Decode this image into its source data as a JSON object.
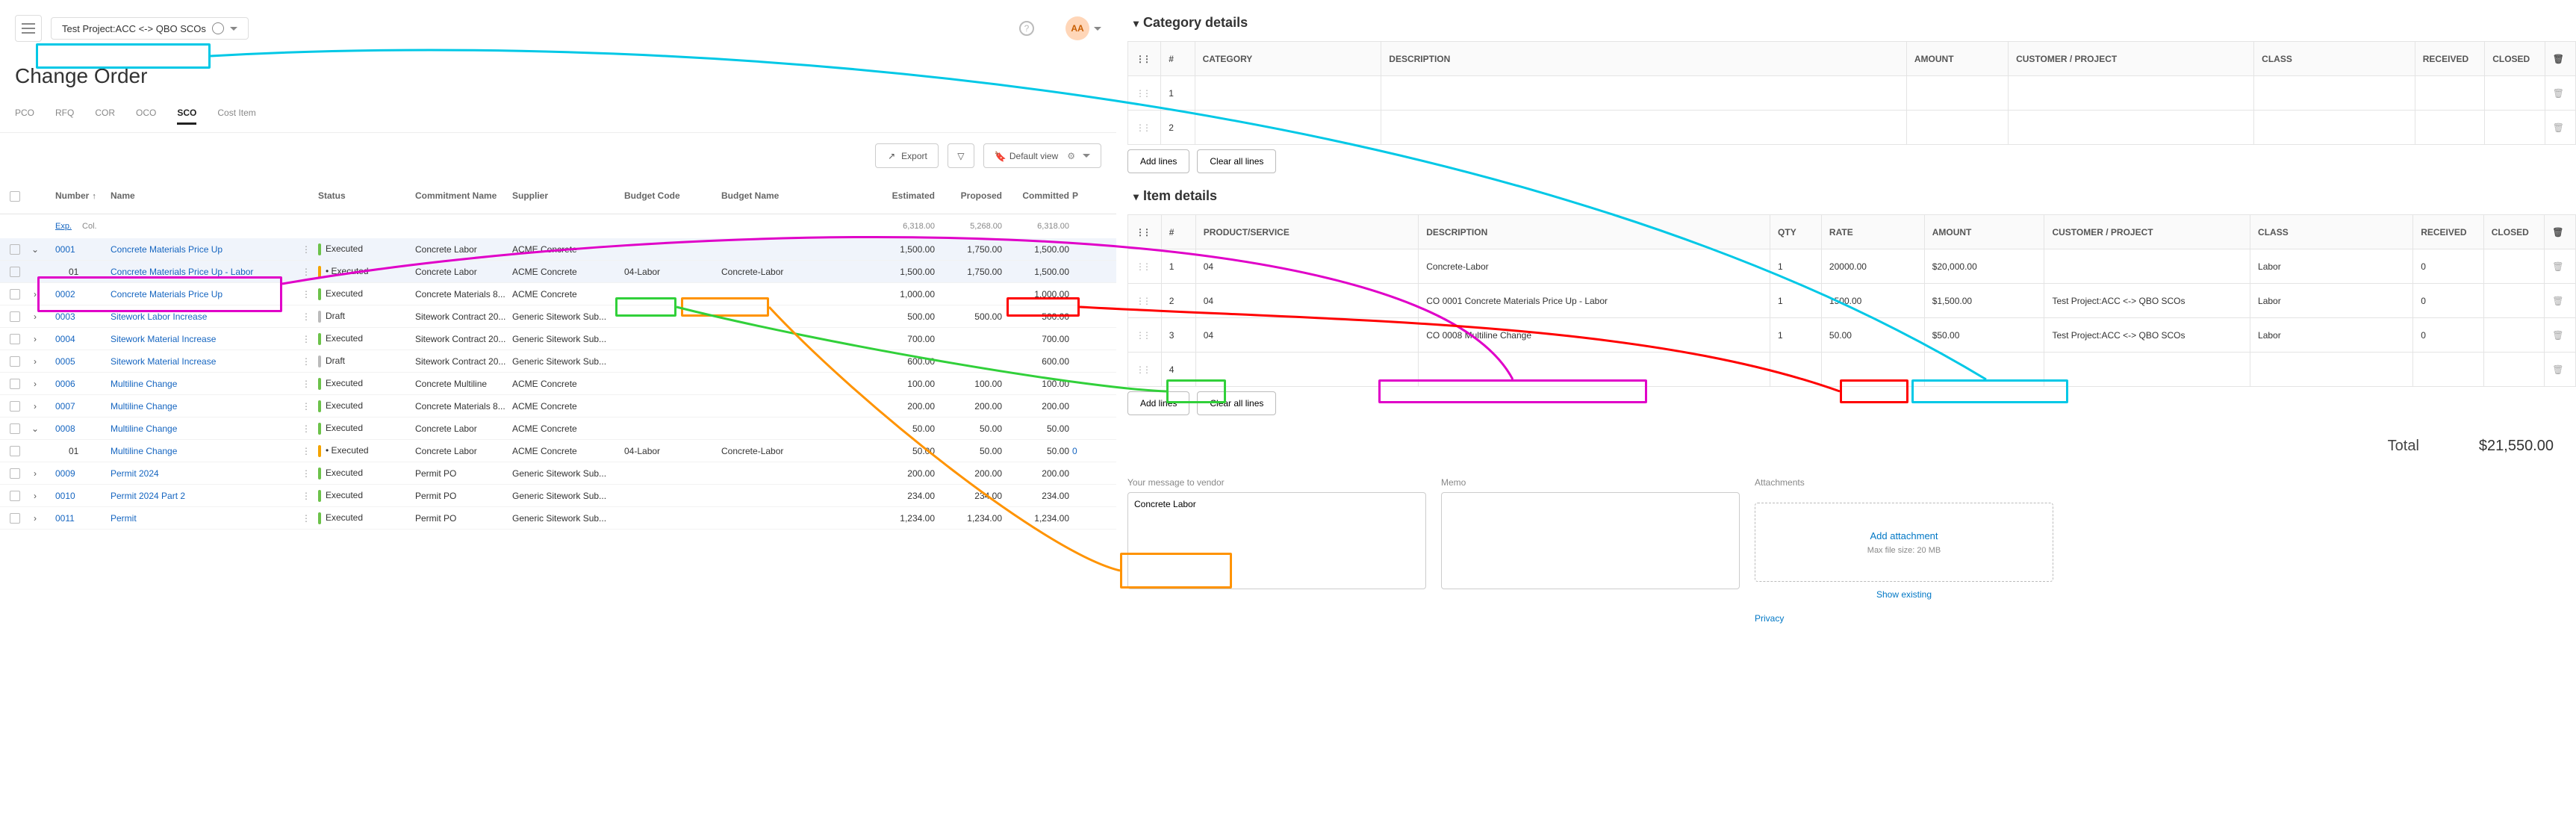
{
  "header": {
    "project_name": "Test Project:ACC <-> QBO SCOs",
    "avatar_initials": "AA"
  },
  "page": {
    "title": "Change Order"
  },
  "tabs": {
    "items": [
      "PCO",
      "RFQ",
      "COR",
      "OCO",
      "SCO",
      "Cost Item"
    ],
    "active": "SCO"
  },
  "toolbar": {
    "export": "Export",
    "default_view": "Default view"
  },
  "grid": {
    "columns": {
      "number": "Number",
      "name": "Name",
      "status": "Status",
      "commitment": "Commitment Name",
      "supplier": "Supplier",
      "budget_code": "Budget Code",
      "budget_name": "Budget Name",
      "estimated": "Estimated",
      "proposed": "Proposed",
      "committed": "Committed",
      "p": "P"
    },
    "subtabs": {
      "exp": "Exp.",
      "col": "Col."
    },
    "summary": {
      "estimated": "6,318.00",
      "proposed": "5,268.00",
      "committed": "6,318.00"
    },
    "rows": [
      {
        "exp": "v",
        "number": "0001",
        "name": "Concrete Materials Price Up",
        "status": "Executed",
        "status_cls": "status-exec",
        "commitment": "Concrete Labor",
        "supplier": "ACME Concrete",
        "budget_code": "",
        "budget_name": "",
        "estimated": "1,500.00",
        "proposed": "1,750.00",
        "committed": "1,500.00",
        "p": ""
      },
      {
        "exp": "",
        "number": "01",
        "name": "Concrete Materials Price Up - Labor",
        "status": "Executed",
        "status_cls": "status-ext",
        "commitment": "Concrete Labor",
        "supplier": "ACME Concrete",
        "budget_code": "04-Labor",
        "budget_name": "Concrete-Labor",
        "estimated": "1,500.00",
        "proposed": "1,750.00",
        "committed": "1,500.00",
        "p": ""
      },
      {
        "exp": ">",
        "number": "0002",
        "name": "Concrete Materials Price Up",
        "status": "Executed",
        "status_cls": "status-exec",
        "commitment": "Concrete Materials 8...",
        "supplier": "ACME Concrete",
        "budget_code": "",
        "budget_name": "",
        "estimated": "1,000.00",
        "proposed": "",
        "committed": "1,000.00",
        "p": ""
      },
      {
        "exp": ">",
        "number": "0003",
        "name": "Sitework Labor Increase",
        "status": "Draft",
        "status_cls": "status-draft",
        "commitment": "Sitework Contract 20...",
        "supplier": "Generic Sitework Sub...",
        "budget_code": "",
        "budget_name": "",
        "estimated": "500.00",
        "proposed": "500.00",
        "committed": "500.00",
        "p": ""
      },
      {
        "exp": ">",
        "number": "0004",
        "name": "Sitework Material Increase",
        "status": "Executed",
        "status_cls": "status-exec",
        "commitment": "Sitework Contract 20...",
        "supplier": "Generic Sitework Sub...",
        "budget_code": "",
        "budget_name": "",
        "estimated": "700.00",
        "proposed": "",
        "committed": "700.00",
        "p": ""
      },
      {
        "exp": ">",
        "number": "0005",
        "name": "Sitework Material Increase",
        "status": "Draft",
        "status_cls": "status-draft",
        "commitment": "Sitework Contract 20...",
        "supplier": "Generic Sitework Sub...",
        "budget_code": "",
        "budget_name": "",
        "estimated": "600.00",
        "proposed": "",
        "committed": "600.00",
        "p": ""
      },
      {
        "exp": ">",
        "number": "0006",
        "name": "Multiline Change",
        "status": "Executed",
        "status_cls": "status-exec",
        "commitment": "Concrete Multiline",
        "supplier": "ACME Concrete",
        "budget_code": "",
        "budget_name": "",
        "estimated": "100.00",
        "proposed": "100.00",
        "committed": "100.00",
        "p": ""
      },
      {
        "exp": ">",
        "number": "0007",
        "name": "Multiline Change",
        "status": "Executed",
        "status_cls": "status-exec",
        "commitment": "Concrete Materials 8...",
        "supplier": "ACME Concrete",
        "budget_code": "",
        "budget_name": "",
        "estimated": "200.00",
        "proposed": "200.00",
        "committed": "200.00",
        "p": ""
      },
      {
        "exp": "v",
        "number": "0008",
        "name": "Multiline Change",
        "status": "Executed",
        "status_cls": "status-exec",
        "commitment": "Concrete Labor",
        "supplier": "ACME Concrete",
        "budget_code": "",
        "budget_name": "",
        "estimated": "50.00",
        "proposed": "50.00",
        "committed": "50.00",
        "p": ""
      },
      {
        "exp": "",
        "number": "01",
        "name": "Multiline Change",
        "status": "Executed",
        "status_cls": "status-ext",
        "commitment": "Concrete Labor",
        "supplier": "ACME Concrete",
        "budget_code": "04-Labor",
        "budget_name": "Concrete-Labor",
        "estimated": "50.00",
        "proposed": "50.00",
        "committed": "50.00",
        "p": "0"
      },
      {
        "exp": ">",
        "number": "0009",
        "name": "Permit 2024",
        "status": "Executed",
        "status_cls": "status-exec",
        "commitment": "Permit PO",
        "supplier": "Generic Sitework Sub...",
        "budget_code": "",
        "budget_name": "",
        "estimated": "200.00",
        "proposed": "200.00",
        "committed": "200.00",
        "p": ""
      },
      {
        "exp": ">",
        "number": "0010",
        "name": "Permit 2024 Part 2",
        "status": "Executed",
        "status_cls": "status-exec",
        "commitment": "Permit PO",
        "supplier": "Generic Sitework Sub...",
        "budget_code": "",
        "budget_name": "",
        "estimated": "234.00",
        "proposed": "234.00",
        "committed": "234.00",
        "p": ""
      },
      {
        "exp": ">",
        "number": "0011",
        "name": "Permit",
        "status": "Executed",
        "status_cls": "status-exec",
        "commitment": "Permit PO",
        "supplier": "Generic Sitework Sub...",
        "budget_code": "",
        "budget_name": "",
        "estimated": "1,234.00",
        "proposed": "1,234.00",
        "committed": "1,234.00",
        "p": ""
      }
    ]
  },
  "qbo": {
    "category": {
      "title": "Category details",
      "columns": {
        "n": "#",
        "cat": "CATEGORY",
        "desc": "DESCRIPTION",
        "amount": "AMOUNT",
        "cust": "CUSTOMER / PROJECT",
        "class": "CLASS",
        "rec": "RECEIVED",
        "closed": "CLOSED"
      },
      "rows": [
        {
          "n": "1"
        },
        {
          "n": "2"
        }
      ],
      "add": "Add lines",
      "clear": "Clear all lines"
    },
    "item": {
      "title": "Item details",
      "columns": {
        "n": "#",
        "prod": "PRODUCT/SERVICE",
        "desc": "DESCRIPTION",
        "qty": "QTY",
        "rate": "RATE",
        "amount": "AMOUNT",
        "cust": "CUSTOMER / PROJECT",
        "class": "CLASS",
        "rec": "RECEIVED",
        "closed": "CLOSED"
      },
      "rows": [
        {
          "n": "1",
          "prod": "04",
          "desc": "Concrete-Labor",
          "qty": "1",
          "rate": "20000.00",
          "amount": "$20,000.00",
          "cust": "",
          "class": "Labor",
          "rec": "0",
          "closed": ""
        },
        {
          "n": "2",
          "prod": "04",
          "desc": "CO 0001 Concrete Materials Price Up - Labor",
          "qty": "1",
          "rate": "1500.00",
          "amount": "$1,500.00",
          "cust": "Test Project:ACC <-> QBO SCOs",
          "class": "Labor",
          "rec": "0",
          "closed": ""
        },
        {
          "n": "3",
          "prod": "04",
          "desc": "CO 0008 Multiline Change",
          "qty": "1",
          "rate": "50.00",
          "amount": "$50.00",
          "cust": "Test Project:ACC <-> QBO SCOs",
          "class": "Labor",
          "rec": "0",
          "closed": ""
        },
        {
          "n": "4",
          "prod": "",
          "desc": "",
          "qty": "",
          "rate": "",
          "amount": "",
          "cust": "",
          "class": "",
          "rec": "",
          "closed": ""
        }
      ],
      "add": "Add lines",
      "clear": "Clear all lines"
    },
    "total": {
      "label": "Total",
      "value": "$21,550.00"
    },
    "memo": {
      "vendor_label": "Your message to vendor",
      "vendor_value": "Concrete Labor",
      "memo_label": "Memo",
      "attach_label": "Attachments",
      "attach_add": "Add attachment",
      "attach_max": "Max file size: 20 MB",
      "show_existing": "Show existing",
      "privacy": "Privacy"
    }
  },
  "annotations": {
    "colors": {
      "cyan": "#00c8e6",
      "magenta": "#e000c8",
      "red": "#ff0000",
      "green": "#31d03a",
      "orange": "#ff9300"
    }
  }
}
